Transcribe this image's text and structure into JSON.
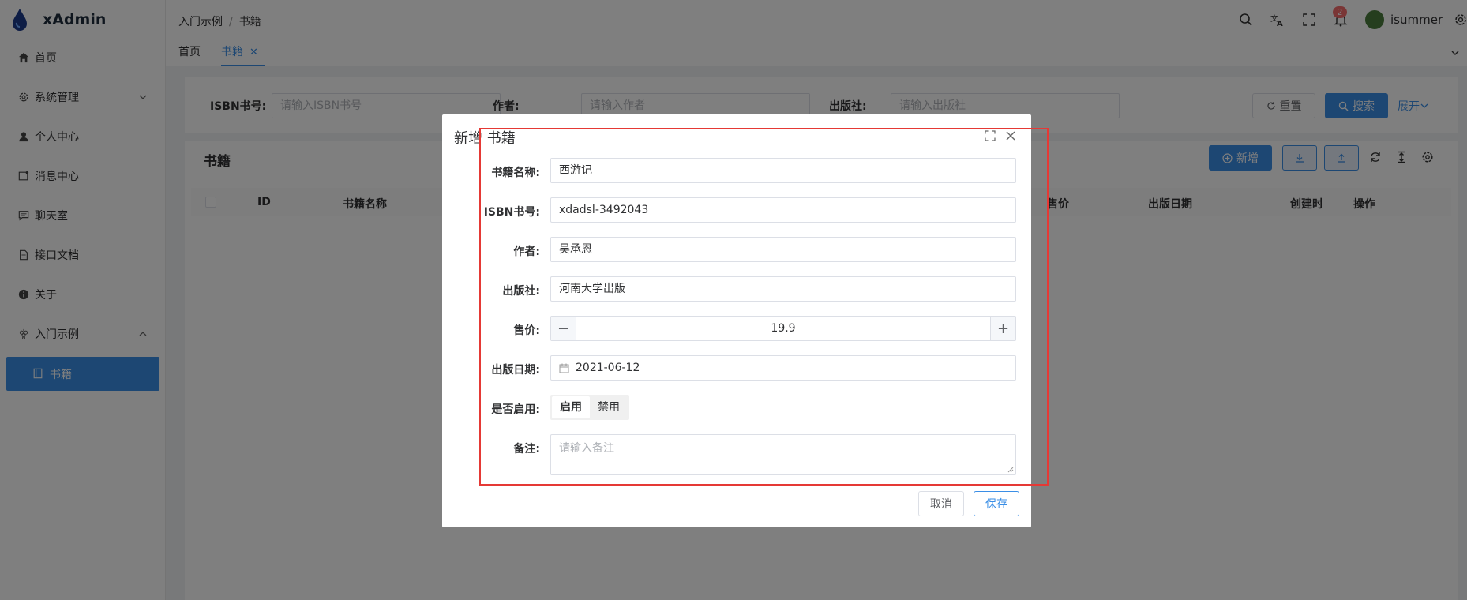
{
  "app": {
    "name": "xAdmin"
  },
  "sidebar": {
    "items": [
      {
        "label": "首页",
        "icon": "home-icon"
      },
      {
        "label": "系统管理",
        "icon": "gear-icon"
      },
      {
        "label": "个人中心",
        "icon": "user-icon"
      },
      {
        "label": "消息中心",
        "icon": "message-icon"
      },
      {
        "label": "聊天室",
        "icon": "chat-icon"
      },
      {
        "label": "接口文档",
        "icon": "doc-icon"
      },
      {
        "label": "关于",
        "icon": "info-icon"
      },
      {
        "label": "入门示例",
        "icon": "grape-icon"
      }
    ],
    "active_item": {
      "label": "书籍",
      "icon": "book-icon"
    }
  },
  "header": {
    "breadcrumb": [
      "入门示例",
      "书籍"
    ],
    "notification_count": "2",
    "username": "isummer"
  },
  "tabs": [
    {
      "label": "首页"
    },
    {
      "label": "书籍",
      "active": true,
      "close": "✕"
    }
  ],
  "search": {
    "isbn_label": "ISBN书号:",
    "isbn_placeholder": "请输入ISBN书号",
    "author_label": "作者:",
    "author_placeholder": "请输入作者",
    "publisher_label": "出版社:",
    "publisher_placeholder": "请输入出版社",
    "reset": "重置",
    "search": "搜索",
    "expand": "展开"
  },
  "table": {
    "title": "书籍",
    "add": "新增",
    "columns": [
      "ID",
      "书籍名称",
      "售价",
      "出版日期",
      "创建时",
      "操作"
    ]
  },
  "dialog": {
    "title": "新增 书籍",
    "fields": {
      "name_label": "书籍名称:",
      "name_value": "西游记",
      "isbn_label": "ISBN书号:",
      "isbn_value": "xdadsl-3492043",
      "author_label": "作者:",
      "author_value": "吴承恩",
      "publisher_label": "出版社:",
      "publisher_value": "河南大学出版",
      "price_label": "售价:",
      "price_value": "19.9",
      "date_label": "出版日期:",
      "date_value": "2021-06-12",
      "enabled_label": "是否启用:",
      "enabled_on": "启用",
      "enabled_off": "禁用",
      "remark_label": "备注:",
      "remark_placeholder": "请输入备注"
    },
    "cancel": "取消",
    "save": "保存"
  },
  "colors": {
    "primary": "#3a8ee6",
    "annotation": "#e53935",
    "badge": "#f56c6c"
  }
}
